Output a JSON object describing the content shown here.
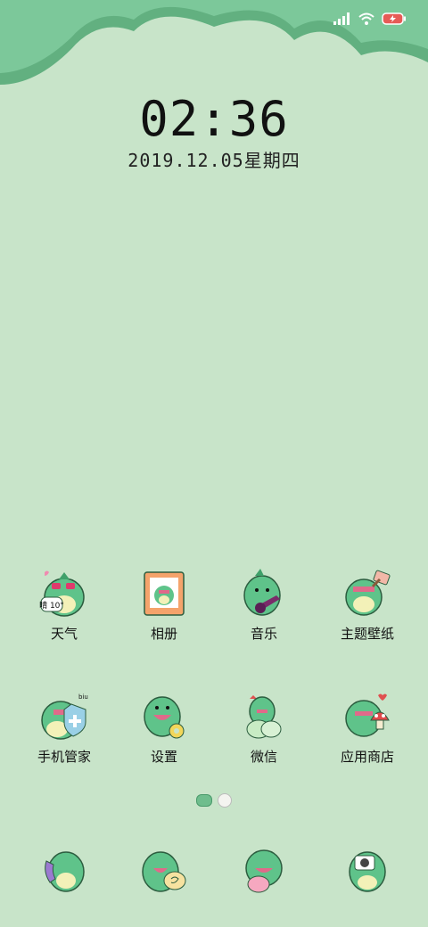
{
  "status": {
    "battery_color": "#e65b56",
    "icons": [
      "signal-icon",
      "wifi-icon",
      "battery-charging-icon"
    ]
  },
  "clock": {
    "time": "02:36",
    "date": "2019.12.05星期四"
  },
  "theme": {
    "background": "#c8e4c9",
    "scallop": "#7cc89a",
    "scallop_dark": "#62b080",
    "dino": "#5fc38a"
  },
  "apps_row1": [
    {
      "label": "天气",
      "icon": "weather-dino-icon",
      "badge": "晴 10°"
    },
    {
      "label": "相册",
      "icon": "album-dino-icon"
    },
    {
      "label": "音乐",
      "icon": "music-dino-icon"
    },
    {
      "label": "主题壁纸",
      "icon": "theme-dino-icon"
    }
  ],
  "apps_row2": [
    {
      "label": "手机管家",
      "icon": "security-dino-icon",
      "badge": "biu"
    },
    {
      "label": "设置",
      "icon": "settings-dino-icon"
    },
    {
      "label": "微信",
      "icon": "wechat-dino-icon"
    },
    {
      "label": "应用商店",
      "icon": "appstore-dino-icon"
    }
  ],
  "dock": [
    {
      "icon": "phone-dino-icon"
    },
    {
      "icon": "messages-dino-icon"
    },
    {
      "icon": "browser-dino-icon"
    },
    {
      "icon": "camera-dino-icon"
    }
  ],
  "pages": {
    "count": 2,
    "current": 1
  }
}
